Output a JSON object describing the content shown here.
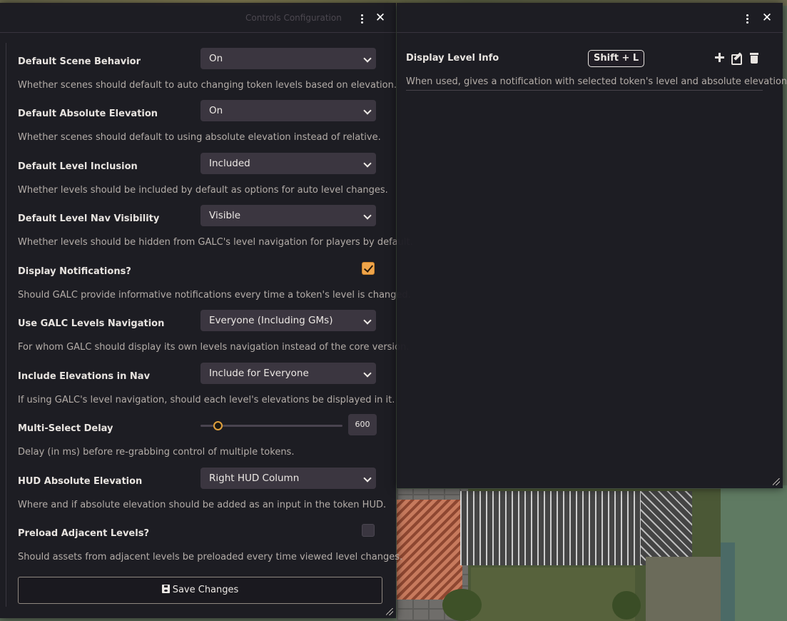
{
  "settings_window": {
    "title": "Controls Configuration",
    "settings": [
      {
        "label": "Default Scene Behavior",
        "control": "select",
        "value": "On",
        "hint": "Whether scenes should default to auto changing token levels based on elevation."
      },
      {
        "label": "Default Absolute Elevation",
        "control": "select",
        "value": "On",
        "hint": "Whether scenes should default to using absolute elevation instead of relative."
      },
      {
        "label": "Default Level Inclusion",
        "control": "select",
        "value": "Included",
        "hint": "Whether levels should be included by default as options for auto level changes."
      },
      {
        "label": "Default Level Nav Visibility",
        "control": "select",
        "value": "Visible",
        "hint": "Whether levels should be hidden from GALC's level navigation for players by default."
      },
      {
        "label": "Display Notifications?",
        "control": "checkbox",
        "checked": true,
        "hint": "Should GALC provide informative notifications every time a token's level is changed."
      },
      {
        "label": "Use GALC Levels Navigation",
        "control": "select",
        "value": "Everyone (Including GMs)",
        "hint": "For whom GALC should display its own levels navigation instead of the core version."
      },
      {
        "label": "Include Elevations in Nav",
        "control": "select",
        "value": "Include for Everyone",
        "hint": "If using GALC's level navigation, should each level's elevations be displayed in it."
      },
      {
        "label": "Multi-Select Delay",
        "control": "slider",
        "value": "600",
        "fraction": 0.12,
        "hint": "Delay (in ms) before re-grabbing control of multiple tokens."
      },
      {
        "label": "HUD Absolute Elevation",
        "control": "select",
        "value": "Right HUD Column",
        "hint": "Where and if absolute elevation should be added as an input in the token HUD."
      },
      {
        "label": "Preload Adjacent Levels?",
        "control": "checkbox",
        "checked": false,
        "hint": "Should assets from adjacent levels be preloaded every time viewed level changes."
      }
    ],
    "save_label": "Save Changes",
    "save_icon": "floppy-disk-icon"
  },
  "controls_window": {
    "action_label": "Display Level Info",
    "keybinding": "Shift + L",
    "hint": "When used, gives a notification with selected token's level and absolute elevation.",
    "icons": [
      "plus-icon",
      "edit-icon",
      "trash-icon"
    ]
  },
  "colors": {
    "accent": "#f0a54a",
    "window_bg": "#1a1820",
    "input_bg": "#3b3640"
  }
}
